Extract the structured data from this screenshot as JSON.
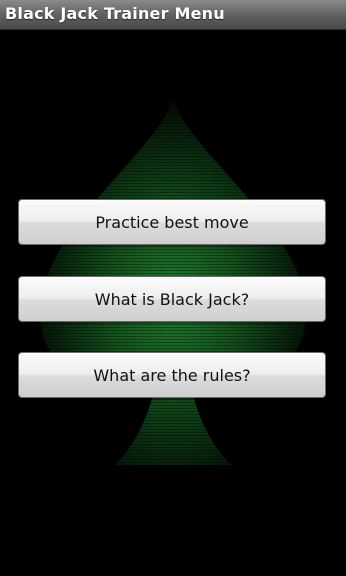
{
  "app": {
    "title": "Black Jack Trainer Menu"
  },
  "background": {
    "icon": "spade-icon",
    "color": "#1f6b2a"
  },
  "menu": {
    "buttons": [
      {
        "label": "Practice best move"
      },
      {
        "label": "What is Black Jack?"
      },
      {
        "label": "What are the rules?"
      }
    ]
  }
}
